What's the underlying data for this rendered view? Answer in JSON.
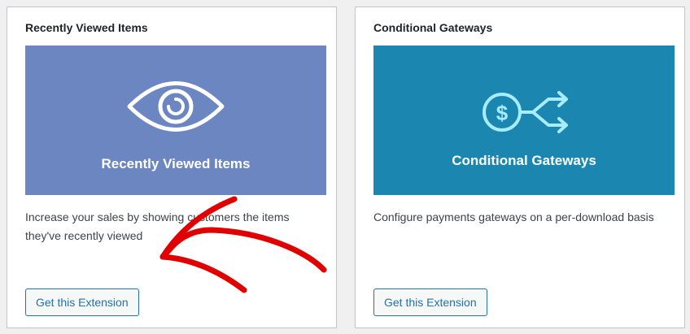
{
  "cards": [
    {
      "title": "Recently Viewed Items",
      "banner_text": "Recently Viewed Items",
      "banner_color": "#6b86c0",
      "icon": "eye-icon",
      "description": "Increase your sales by showing customers the items they've recently viewed",
      "button_label": "Get this Extension"
    },
    {
      "title": "Conditional Gateways",
      "banner_text": "Conditional Gateways",
      "banner_color": "#1b87b0",
      "icon": "dollar-split-icon",
      "description": "Configure payments gateways on a per-download basis",
      "button_label": "Get this Extension"
    }
  ],
  "annotation": {
    "icon": "red-arrow-annotation",
    "color": "#e00000"
  },
  "colors": {
    "accent": "#2271b1",
    "card_border": "#c3c4c7",
    "background": "#f0f0f1"
  }
}
